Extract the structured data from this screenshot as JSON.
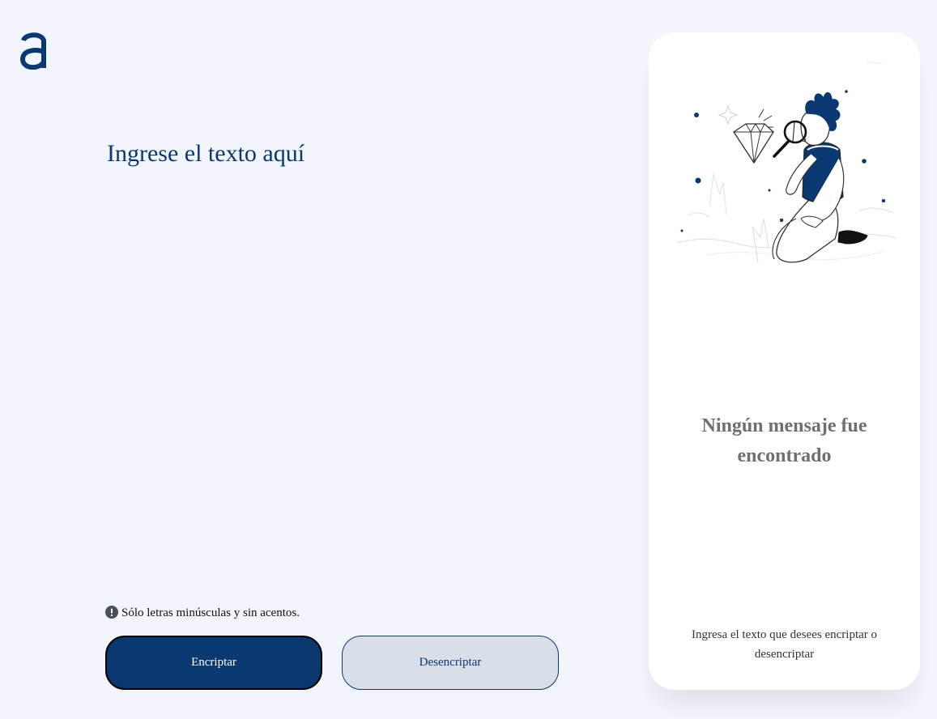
{
  "header": {
    "logo_icon": "alura-logo-icon"
  },
  "editor": {
    "placeholder": "Ingrese el texto aquí",
    "value": ""
  },
  "hint": {
    "icon": "exclamation-circle-icon",
    "text": "Sólo letras minúsculas y sin acentos."
  },
  "actions": {
    "encrypt_label": "Encriptar",
    "decrypt_label": "Desencriptar"
  },
  "result_panel": {
    "illustration": "person-with-magnifier-illustration",
    "title": "Ningún mensaje fue encontrado",
    "description": "Ingresa el texto que desees encriptar o desencriptar"
  },
  "colors": {
    "background": "#f3f5fc",
    "primary": "#0a3871",
    "secondary_button": "#d8dfe8",
    "panel": "#ffffff",
    "title_gray": "#6f6f6f"
  }
}
